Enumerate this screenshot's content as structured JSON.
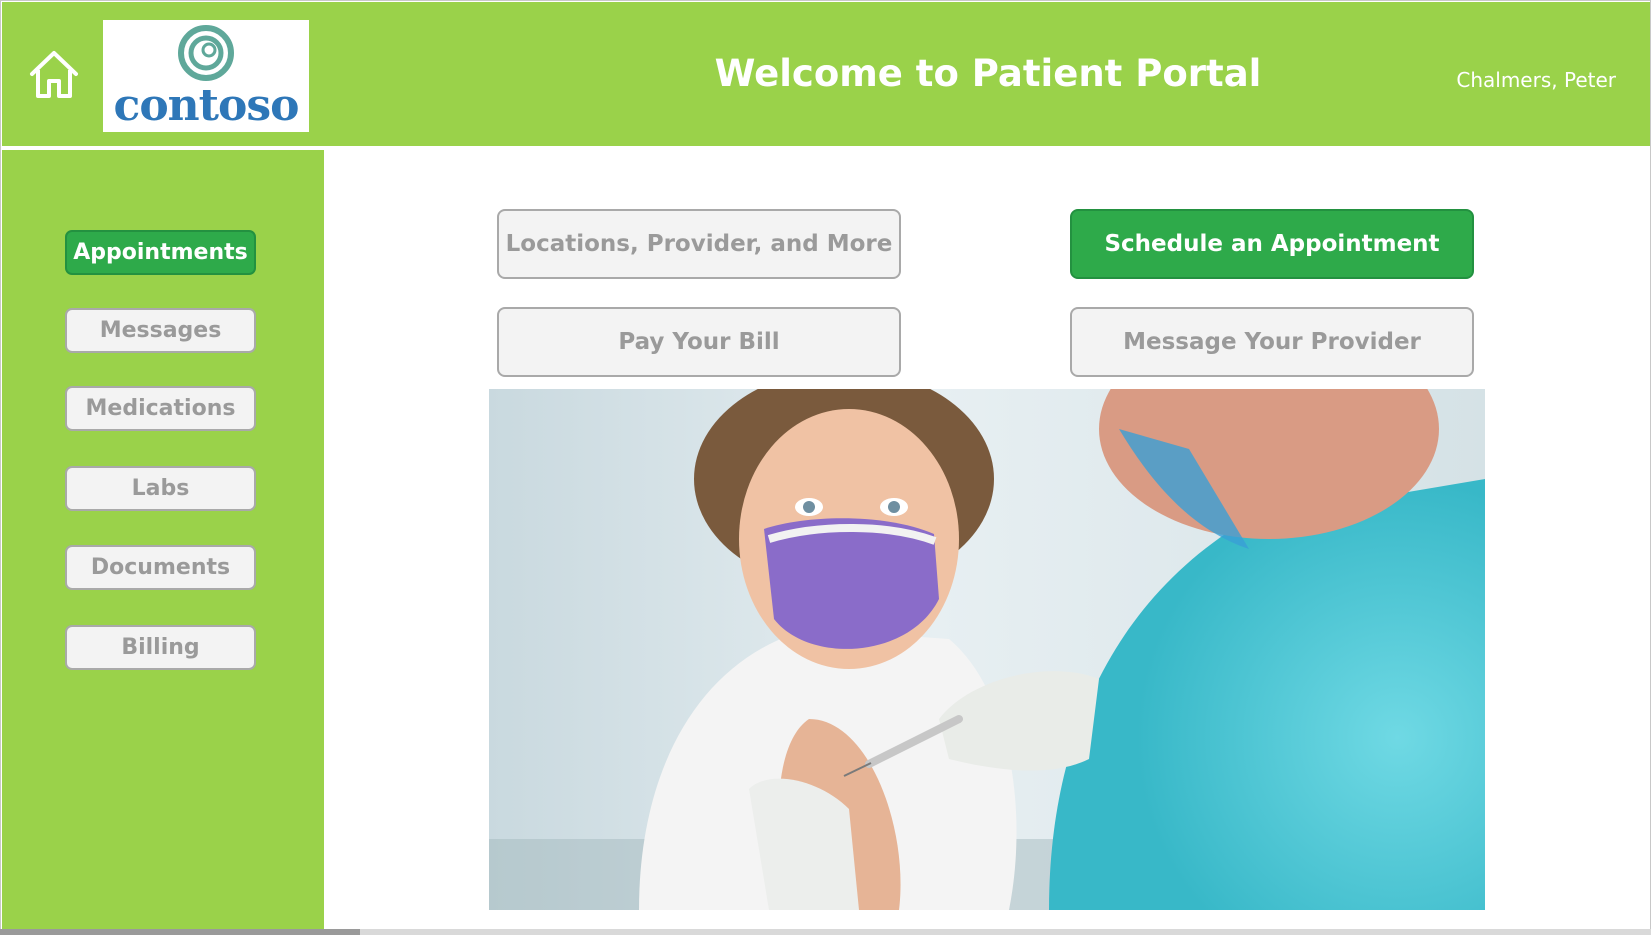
{
  "header": {
    "title": "Welcome to Patient Portal",
    "user_name": "Chalmers, Peter",
    "logo_text": "contoso",
    "home_icon": "home-icon",
    "background_color": "#9ad24a"
  },
  "sidebar": {
    "items": [
      {
        "label": "Appointments",
        "active": true
      },
      {
        "label": "Messages",
        "active": false
      },
      {
        "label": "Medications",
        "active": false
      },
      {
        "label": "Labs",
        "active": false
      },
      {
        "label": "Documents",
        "active": false
      },
      {
        "label": "Billing",
        "active": false
      }
    ]
  },
  "main": {
    "actions": [
      {
        "label": "Locations, Provider, and More",
        "primary": false
      },
      {
        "label": "Schedule an Appointment",
        "primary": true
      },
      {
        "label": "Pay Your Bill",
        "primary": false
      },
      {
        "label": "Message Your Provider",
        "primary": false
      }
    ]
  },
  "colors": {
    "accent_green": "#9ad24a",
    "active_button": "#2eaa4a",
    "inactive_button": "#f3f3f3",
    "logo_blue": "#2e77b8",
    "logo_teal": "#5fa89a"
  }
}
